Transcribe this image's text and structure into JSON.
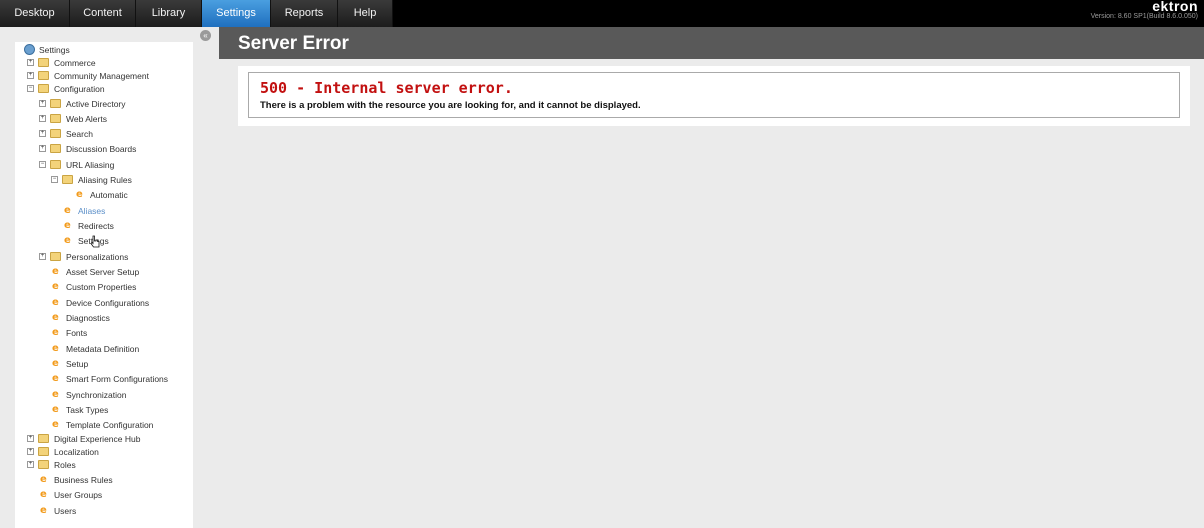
{
  "nav": {
    "tabs": [
      {
        "label": "Desktop"
      },
      {
        "label": "Content"
      },
      {
        "label": "Library"
      },
      {
        "label": "Settings",
        "active": true
      },
      {
        "label": "Reports"
      },
      {
        "label": "Help"
      }
    ]
  },
  "brand": {
    "name": "ektron",
    "version": "Version: 8.60 SP1(Build 8.6.0.050)"
  },
  "sidebar": {
    "root": "Settings",
    "items": [
      {
        "label": "Commerce"
      },
      {
        "label": "Community Management"
      },
      {
        "label": "Configuration"
      },
      {
        "label": "Active Directory"
      },
      {
        "label": "Web Alerts"
      },
      {
        "label": "Search"
      },
      {
        "label": "Discussion Boards"
      },
      {
        "label": "URL Aliasing"
      },
      {
        "label": "Aliasing Rules"
      },
      {
        "label": "Automatic"
      },
      {
        "label": "Aliases"
      },
      {
        "label": "Redirects"
      },
      {
        "label": "Settings"
      },
      {
        "label": "Personalizations"
      },
      {
        "label": "Asset Server Setup"
      },
      {
        "label": "Custom Properties"
      },
      {
        "label": "Device Configurations"
      },
      {
        "label": "Diagnostics"
      },
      {
        "label": "Fonts"
      },
      {
        "label": "Metadata Definition"
      },
      {
        "label": "Setup"
      },
      {
        "label": "Smart Form Configurations"
      },
      {
        "label": "Synchronization"
      },
      {
        "label": "Task Types"
      },
      {
        "label": "Template Configuration"
      },
      {
        "label": "Digital Experience Hub"
      },
      {
        "label": "Localization"
      },
      {
        "label": "Roles"
      },
      {
        "label": "Business Rules"
      },
      {
        "label": "User Groups"
      },
      {
        "label": "Users"
      }
    ]
  },
  "main": {
    "title": "Server Error",
    "error_code": "500 - Internal server error.",
    "error_message": "There is a problem with the resource you are looking for, and it cannot be displayed."
  },
  "colors": {
    "accent": "#2a7fd0",
    "error": "#c21010",
    "header": "#595959"
  },
  "icons": {
    "folder": "folder-icon",
    "expand": "expand-icon",
    "page": "ektron-e-icon",
    "root": "globe-icon"
  }
}
